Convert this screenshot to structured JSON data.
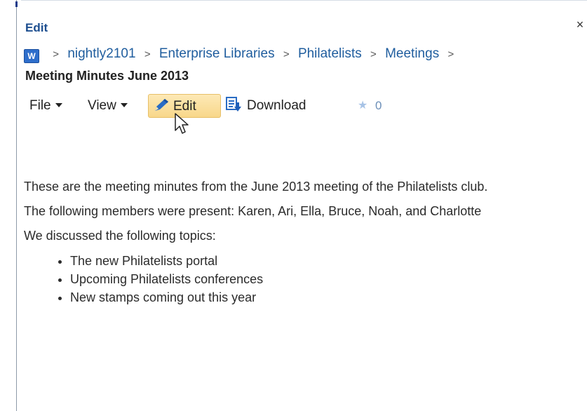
{
  "dialog": {
    "title": "Edit",
    "close_glyph": "×"
  },
  "breadcrumb": {
    "app_icon_letter": "W",
    "app_icon": "word-document-icon",
    "separator": ">",
    "items": [
      "nightly2101",
      "Enterprise Libraries",
      "Philatelists",
      "Meetings"
    ]
  },
  "document": {
    "title": "Meeting Minutes June 2013"
  },
  "toolbar": {
    "file_label": "File",
    "view_label": "View",
    "edit_label": "Edit",
    "download_label": "Download",
    "like_count": "0"
  },
  "content": {
    "paragraphs": [
      "These are the meeting minutes from the June 2013 meeting of the Philatelists club.",
      "The following members were present: Karen, Ari, Ella, Bruce, Noah, and Charlotte",
      "We discussed the following topics:"
    ],
    "topics": [
      "The new Philatelists portal",
      "Upcoming Philatelists conferences",
      "New stamps coming out this year"
    ]
  },
  "colors": {
    "link": "#1f5d9e",
    "edit_highlight": "#f8d78a",
    "title_blue": "#1d4e8f"
  }
}
